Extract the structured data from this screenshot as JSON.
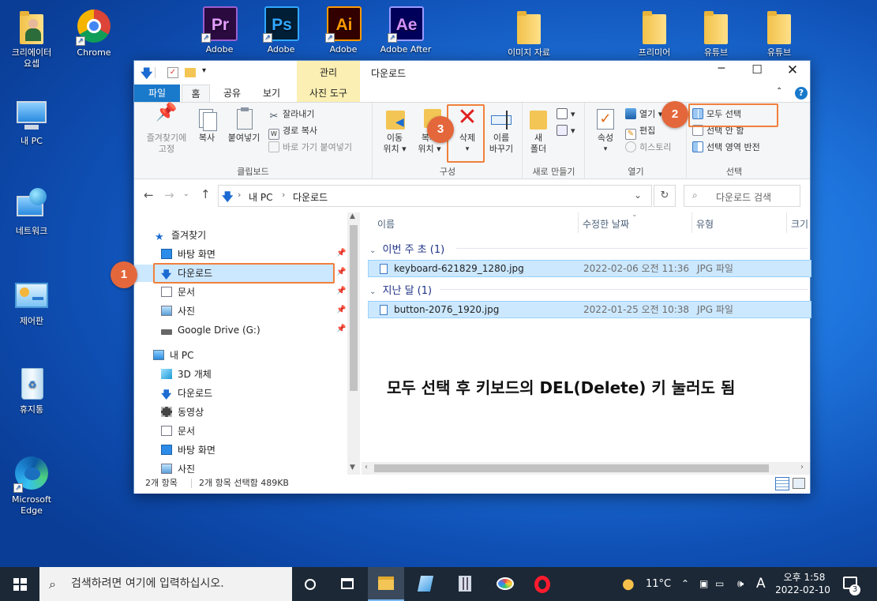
{
  "desktop": {
    "icons": [
      {
        "label_lines": [
          "크리에이터",
          "요셉"
        ],
        "kind": "person"
      },
      {
        "label_lines": [
          "Chrome"
        ],
        "kind": "chrome"
      },
      {
        "label_lines": [
          "Adobe"
        ],
        "kind": "pr",
        "badge": "Pr",
        "color": "#2a0a3f",
        "fg": "#e59cff"
      },
      {
        "label_lines": [
          "Adobe"
        ],
        "kind": "ps",
        "badge": "Ps",
        "color": "#001e36",
        "fg": "#31a8ff"
      },
      {
        "label_lines": [
          "Adobe"
        ],
        "kind": "ai",
        "badge": "Ai",
        "color": "#330000",
        "fg": "#ff9a00"
      },
      {
        "label_lines": [
          "Adobe After"
        ],
        "kind": "ae",
        "badge": "Ae",
        "color": "#00005b",
        "fg": "#d291ff"
      },
      {
        "label_lines": [
          "이미지 자료"
        ],
        "kind": "folder"
      },
      {
        "label_lines": [
          "프리미어"
        ],
        "kind": "folder"
      },
      {
        "label_lines": [
          "유튜브"
        ],
        "kind": "folder"
      },
      {
        "label_lines": [
          "유튜브"
        ],
        "kind": "folder"
      },
      {
        "label_lines": [
          "내 PC"
        ],
        "kind": "pc"
      },
      {
        "label_lines": [
          "네트워크"
        ],
        "kind": "network"
      },
      {
        "label_lines": [
          "제어판"
        ],
        "kind": "control"
      },
      {
        "label_lines": [
          "휴지통"
        ],
        "kind": "bin"
      },
      {
        "label_lines": [
          "Microsoft",
          "Edge"
        ],
        "kind": "edge"
      }
    ]
  },
  "window": {
    "title": "다운로드",
    "context_tab": "관리",
    "tabs": [
      "파일",
      "홈",
      "공유",
      "보기",
      "사진 도구"
    ],
    "active_tab": "홈",
    "ribbon": {
      "clipboard": {
        "pin": "즐겨찾기에\n고정",
        "copy": "복사",
        "paste": "붙여넣기",
        "cut": "잘라내기",
        "copy_path": "경로 복사",
        "paste_shortcut": "바로 가기 붙여넣기",
        "label": "클립보드"
      },
      "organize": {
        "move": "이동\n위치 ▾",
        "copy_to": "복사\n위치 ▾",
        "delete": "삭제",
        "rename": "이름\n바꾸기",
        "label": "구성"
      },
      "new": {
        "new_folder": "새\n폴더",
        "label": "새로 만들기"
      },
      "open": {
        "properties": "속성",
        "open": "열기 ▾",
        "edit": "편집",
        "history": "히스토리",
        "label": "열기"
      },
      "select": {
        "select_all": "모두 선택",
        "select_none": "선택 안 함",
        "invert": "선택 영역 반전",
        "label": "선택"
      }
    },
    "address": {
      "path": [
        "내 PC",
        "다운로드"
      ],
      "search_placeholder": "다운로드 검색"
    },
    "nav": {
      "quick_access": "즐겨찾기",
      "quick_items": [
        "바탕 화면",
        "다운로드",
        "문서",
        "사진",
        "Google Drive (G:)"
      ],
      "this_pc": "내 PC",
      "pc_items": [
        "3D 개체",
        "다운로드",
        "동영상",
        "문서",
        "바탕 화면",
        "사진"
      ]
    },
    "columns": [
      "이름",
      "수정한 날짜",
      "유형",
      "크기"
    ],
    "groups": [
      {
        "title": "이번 주 초 (1)",
        "files": [
          {
            "name": "keyboard-621829_1280.jpg",
            "date": "2022-02-06 오전 11:36",
            "type": "JPG 파일"
          }
        ]
      },
      {
        "title": "지난 달 (1)",
        "files": [
          {
            "name": "button-2076_1920.jpg",
            "date": "2022-01-25 오전 10:38",
            "type": "JPG 파일"
          }
        ]
      }
    ],
    "status": {
      "count": "2개 항목",
      "selected": "2개 항목 선택함 489KB"
    }
  },
  "annotation": {
    "badges": [
      "1",
      "2",
      "3"
    ],
    "note": "모두 선택 후 키보드의 DEL(Delete) 키 눌러도 됨"
  },
  "taskbar": {
    "search_placeholder": "검색하려면 여기에 입력하십시오.",
    "weather": "11°C",
    "ime": "A",
    "time": "오후 1:58",
    "date": "2022-02-10",
    "notification_count": "3"
  }
}
